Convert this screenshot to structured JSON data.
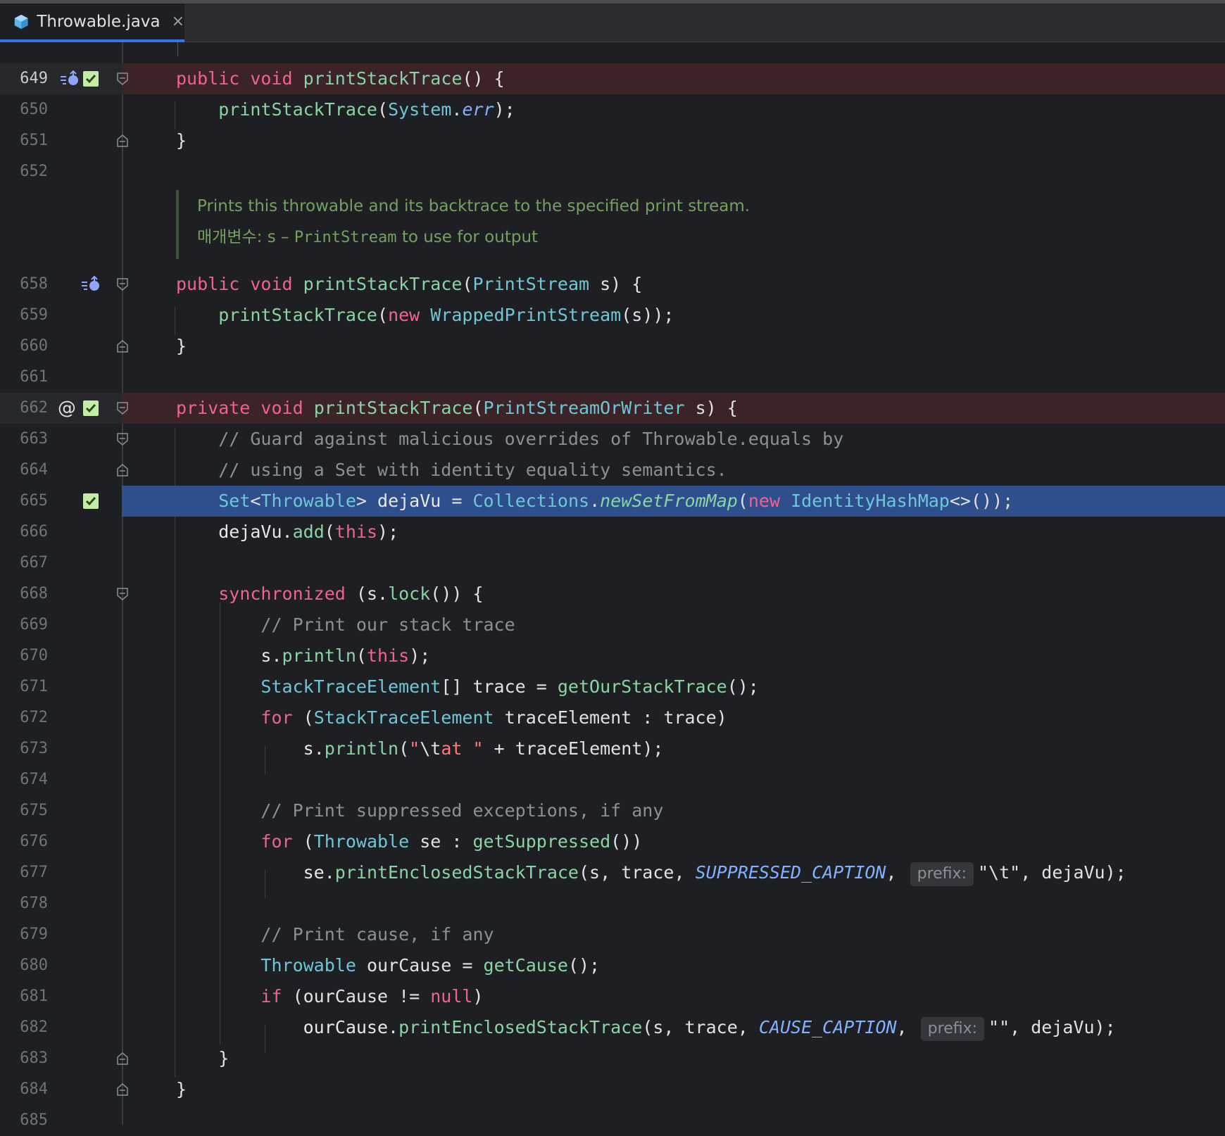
{
  "tab": {
    "title": "Throwable.java",
    "close": "×"
  },
  "doc": {
    "text": "Prints this throwable and its backtrace to the specified print stream.",
    "param_label": "매개변수:",
    "param_name": "s",
    "param_dash": " – ",
    "param_type": "PrintStream",
    "param_rest": " to use for output"
  },
  "lines": {
    "l649": "649",
    "l650": "650",
    "l651": "651",
    "l652": "652",
    "l658": "658",
    "l659": "659",
    "l660": "660",
    "l661": "661",
    "l662": "662",
    "l663": "663",
    "l664": "664",
    "l665": "665",
    "l666": "666",
    "l667": "667",
    "l668": "668",
    "l669": "669",
    "l670": "670",
    "l671": "671",
    "l672": "672",
    "l673": "673",
    "l674": "674",
    "l675": "675",
    "l676": "676",
    "l677": "677",
    "l678": "678",
    "l679": "679",
    "l680": "680",
    "l681": "681",
    "l682": "682",
    "l683": "683",
    "l684": "684",
    "l685": "685"
  },
  "code": {
    "public": "public",
    "private": "private",
    "void": "void",
    "printStackTrace": "printStackTrace",
    "paren_open_brace": "() {",
    "lparen": "(",
    "System": "System",
    "dot": ".",
    "err": "err",
    "rparen_semi": ");",
    "rbrace": "}",
    "PrintStream": "PrintStream",
    "s_brace": " s) {",
    "new": "new",
    "WrappedPrintStream": "WrappedPrintStream",
    "s_close": "(s));",
    "PrintStreamOrWriter": "PrintStreamOrWriter",
    "c663": "// Guard against malicious overrides of Throwable.equals by",
    "c664": "// using a Set with identity equality semantics.",
    "Set": "Set",
    "lt": "<",
    "Throwable": "Throwable",
    "gt_sp": "> ",
    "dejaVu": "dejaVu",
    "eq": " = ",
    "Collections": "Collections",
    "newSetFromMap": "newSetFromMap",
    "IdentityHashMap": "IdentityHashMap",
    "diamond_close": "<>());",
    "add": "add",
    "this": "this",
    "synchronized": "synchronized",
    "s_dot": " (s.",
    "lock": "lock",
    "lock_close": "()) {",
    "c669": "// Print our stack trace",
    "s": "s",
    "println": "println",
    "StackTraceElement": "StackTraceElement",
    "arr_trace": "[] trace = ",
    "getOurStackTrace": "getOurStackTrace",
    "call_semi": "();",
    "for": "for",
    "sp_lparen": " (",
    "traceElement_colon_trace": " traceElement : trace)",
    "str_open": "\"",
    "esc_t": "\\t",
    "str_at": "at \"",
    "plus_te": " + traceElement);",
    "c675": "// Print suppressed exceptions, if any",
    "se_colon": " se : ",
    "getSuppressed": "getSuppressed",
    "call_close": "())",
    "se": "se",
    "printEnclosedStackTrace": "printEnclosedStackTrace",
    "s_trace": "(s, trace, ",
    "SUPPRESSED_CAPTION": "SUPPRESSED_CAPTION",
    "comma": ",",
    "prefix_hint": "prefix:",
    "tab_str": "\"\\t\"",
    "dejaVu_close": ", dejaVu);",
    "c679": "// Print cause, if any",
    "ourCause_eq": " ourCause = ",
    "getCause": "getCause",
    "if": "if",
    "ourCause_neq": " (ourCause != ",
    "null": "null",
    "rparen": ")",
    "ourCause": "ourCause",
    "CAUSE_CAPTION": "CAUSE_CAPTION",
    "empty_str": "\"\""
  },
  "colors": {
    "background": "#1e1f22",
    "keyword": "#f06292",
    "function": "#8ad3a6",
    "type": "#6fc6d6",
    "comment": "#8c9096",
    "string": "#ff7a78",
    "doc": "#75a062",
    "selection": "#2f4f8c",
    "breakpoint_line": "#3b2327"
  },
  "icons": {
    "tab": "java-class-icon",
    "override": "implementing-method-icon",
    "check": "checkmark-icon",
    "fold": "fold-icon",
    "annotation": "at-icon"
  }
}
